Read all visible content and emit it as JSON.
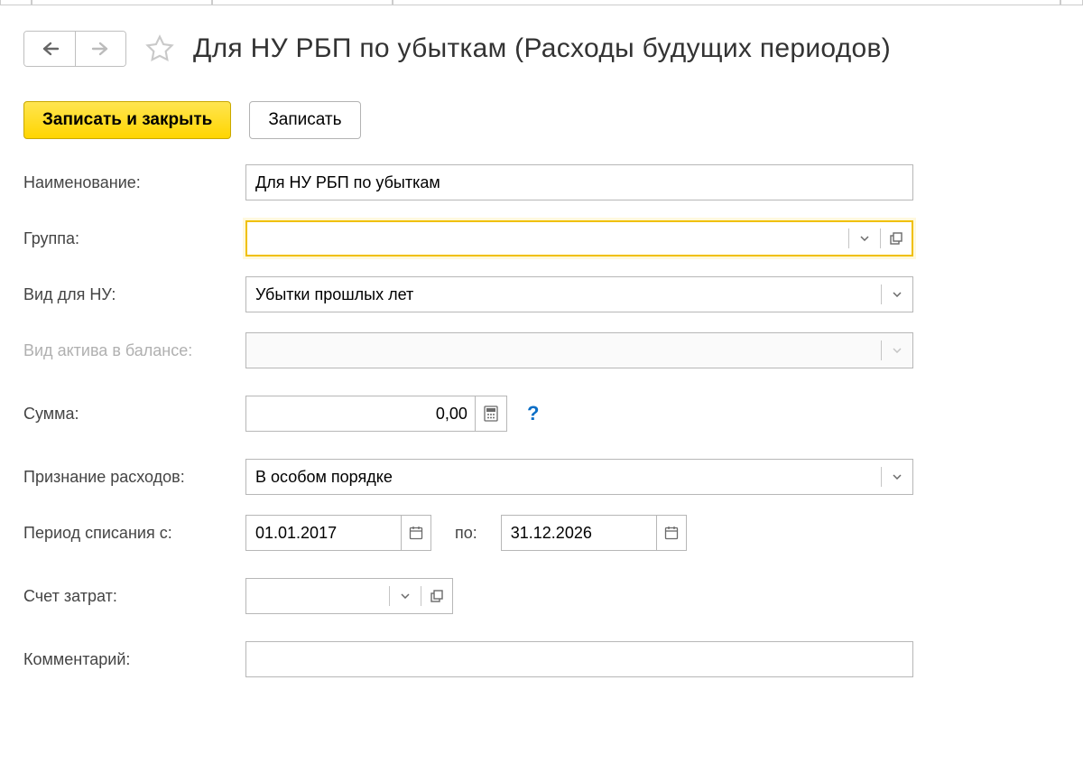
{
  "header": {
    "title": "Для НУ РБП по убыткам (Расходы будущих периодов)"
  },
  "toolbar": {
    "save_close_label": "Записать и закрыть",
    "save_label": "Записать"
  },
  "labels": {
    "name": "Наименование:",
    "group": "Группа:",
    "nu_type": "Вид для НУ:",
    "asset_type": "Вид актива в балансе:",
    "amount": "Сумма:",
    "expense_recognition": "Признание расходов:",
    "writeoff_period": "Период списания с:",
    "writeoff_to": "по:",
    "expense_account": "Счет затрат:",
    "comment": "Комментарий:"
  },
  "values": {
    "name": "Для НУ РБП по убыткам",
    "group": "",
    "nu_type": "Убытки прошлых лет",
    "asset_type": "",
    "amount": "0,00",
    "expense_recognition": "В особом порядке",
    "period_from": "01.01.2017",
    "period_to": "31.12.2026",
    "expense_account": "",
    "comment": ""
  },
  "hint": "?"
}
